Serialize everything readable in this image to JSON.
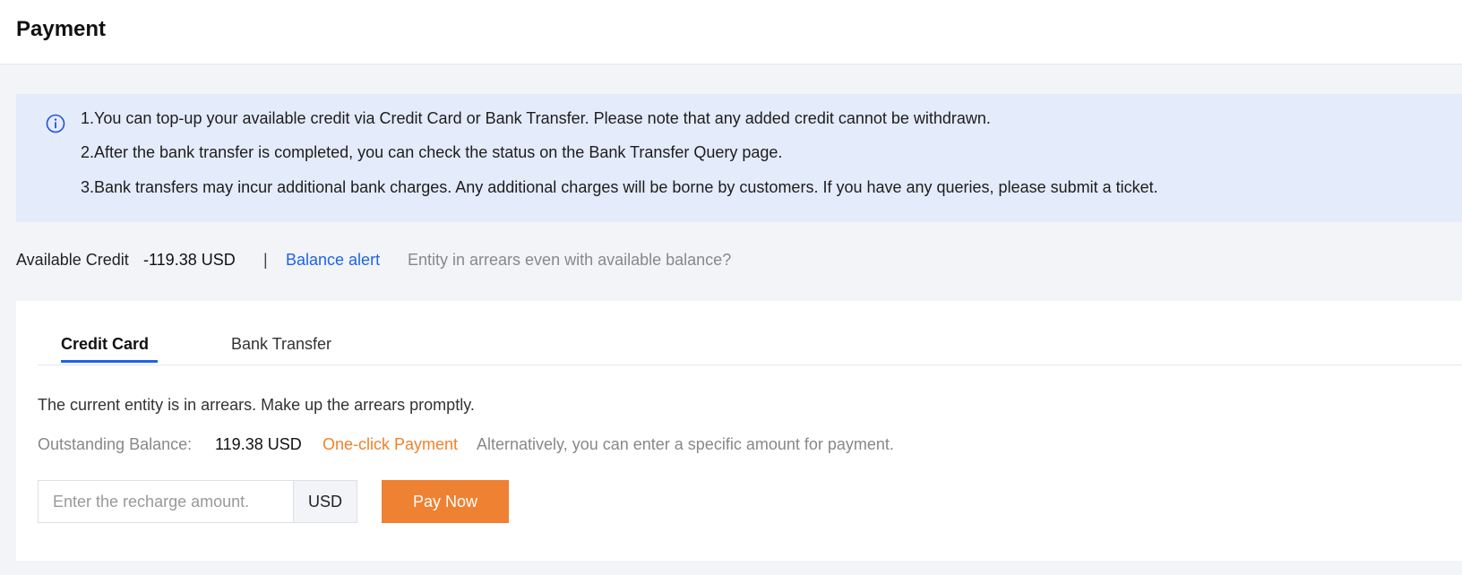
{
  "header": {
    "title": "Payment"
  },
  "notice": {
    "icon": "info-circle-icon",
    "lines": [
      "1.You can top-up your available credit via Credit Card or Bank Transfer. Please note that any added credit cannot be withdrawn.",
      "2.After the bank transfer is completed, you can check the status on the Bank Transfer Query page.",
      "3.Bank transfers may incur additional bank charges. Any additional charges will be borne by customers. If you have any queries, please submit a ticket."
    ]
  },
  "credit": {
    "label": "Available Credit",
    "value": "-119.38 USD",
    "separator": "|",
    "balance_alert": "Balance alert",
    "arrears_help": "Entity in arrears even with available balance?"
  },
  "tabs": [
    {
      "label": "Credit Card",
      "active": true
    },
    {
      "label": "Bank Transfer",
      "active": false
    }
  ],
  "payment": {
    "arrears_message": "The current entity is in arrears. Make up the arrears promptly.",
    "outstanding_label": "Outstanding Balance:",
    "outstanding_value": "119.38 USD",
    "one_click": "One-click Payment",
    "alternative_text": "Alternatively, you can enter a specific amount for payment.",
    "amount_placeholder": "Enter the recharge amount.",
    "unit": "USD",
    "pay_button": "Pay Now"
  },
  "colors": {
    "accent_blue": "#1e63e9",
    "accent_orange": "#ef8133",
    "notice_bg": "#e4ebfb",
    "page_bg": "#f2f4f8"
  }
}
